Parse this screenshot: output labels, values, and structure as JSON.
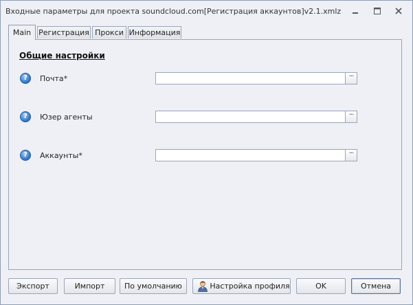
{
  "window": {
    "title": "Входные параметры для проекта soundcloud.com[Регистрация аккаунтов]v2.1.xmlz"
  },
  "tabs": [
    {
      "label": "Main",
      "active": true
    },
    {
      "label": "Регистрация",
      "active": false
    },
    {
      "label": "Прокси",
      "active": false
    },
    {
      "label": "Информация",
      "active": false
    }
  ],
  "section": {
    "title": "Общие настройки"
  },
  "fields": [
    {
      "label": "Почта*",
      "value": ""
    },
    {
      "label": "Юзер агенты",
      "value": ""
    },
    {
      "label": "Аккаунты*",
      "value": ""
    }
  ],
  "help_glyph": "?",
  "browse_glyph": "···",
  "buttons": {
    "export": "Экспорт",
    "import": "Импорт",
    "defaults": "По умолчанию",
    "profile": "Настройка профиля",
    "ok": "OK",
    "cancel": "Отмена"
  },
  "icons": {
    "help": "help-circle-icon",
    "profile": "user-profile-icon",
    "minimize": "minimize-icon",
    "maximize": "maximize-icon",
    "close": "close-icon"
  }
}
